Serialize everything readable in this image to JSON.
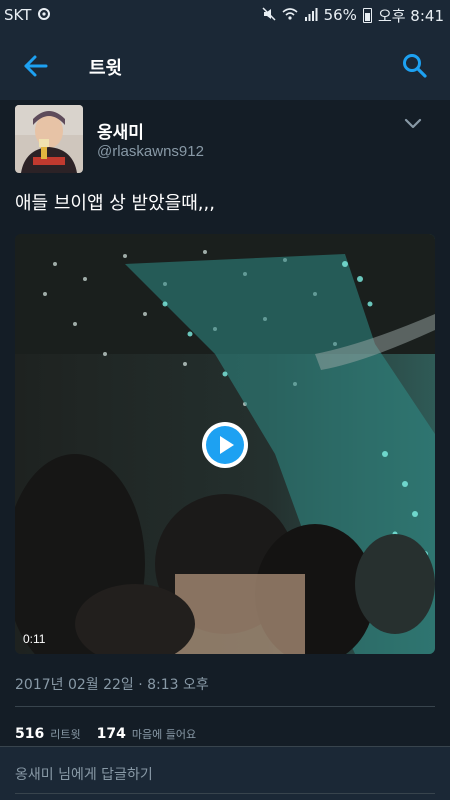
{
  "status_bar": {
    "carrier": "SKT",
    "battery_percent": "56%",
    "time": "오후 8:41"
  },
  "header": {
    "title": "트윗"
  },
  "tweet": {
    "display_name": "옹새미",
    "handle": "@rlaskawns912",
    "text": "애들 브이앱 상 받았을때,,,",
    "media": {
      "duration": "0:11"
    },
    "timestamp": "2017년 02월 22일 · 8:13 오후",
    "stats": {
      "retweets_count": "516",
      "retweets_label": "리트윗",
      "likes_count": "174",
      "likes_label": "마음에 들어요"
    }
  },
  "reply": {
    "placeholder": "옹새미 님에게 답글하기"
  },
  "colors": {
    "background": "#141d26",
    "bar": "#1b2836",
    "accent": "#1da1f2",
    "secondary_text": "#8899a6"
  },
  "icons": [
    "back-arrow-icon",
    "search-icon",
    "chevron-down-icon",
    "play-icon",
    "mute-icon",
    "wifi-icon",
    "signal-icon",
    "battery-icon"
  ]
}
